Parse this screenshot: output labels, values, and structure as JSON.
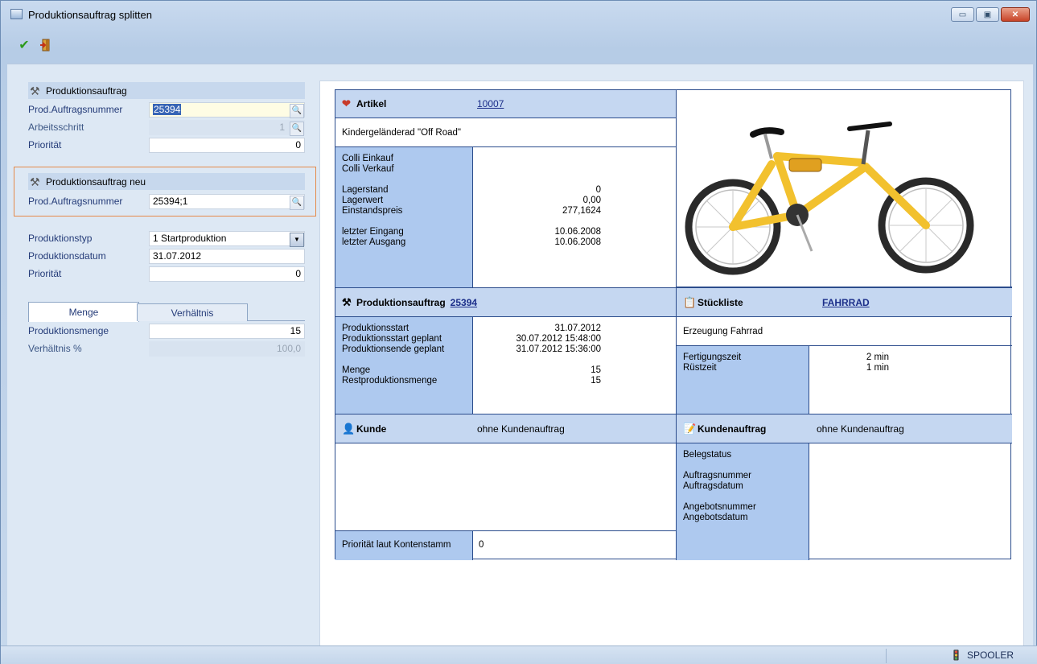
{
  "window": {
    "title": "Produktionsauftrag splitten",
    "controls": {
      "minimize": "▭",
      "maximize": "▣",
      "close": "✕"
    }
  },
  "toolbar": {
    "confirm_icon": "✔",
    "exit_icon": "🚪"
  },
  "left": {
    "group1": {
      "title": "Produktionsauftrag",
      "prod_nr_label": "Prod.Auftragsnummer",
      "prod_nr_value": "25394",
      "arbeitsschritt_label": "Arbeitsschritt",
      "arbeitsschritt_value": "1",
      "prioritaet_label": "Priorität",
      "prioritaet_value": "0"
    },
    "group2": {
      "title": "Produktionsauftrag neu",
      "prod_nr_label": "Prod.Auftragsnummer",
      "prod_nr_value": "25394;1"
    },
    "fields": {
      "produktionstyp_label": "Produktionstyp",
      "produktionstyp_value": "1 Startproduktion",
      "produktionsdatum_label": "Produktionsdatum",
      "produktionsdatum_value": "31.07.2012",
      "prioritaet_label": "Priorität",
      "prioritaet_value": "0"
    },
    "tabs": {
      "menge": "Menge",
      "verhaeltnis": "Verhältnis"
    },
    "tabcontent": {
      "produktionsmenge_label": "Produktionsmenge",
      "produktionsmenge_value": "15",
      "verhaeltnis_label": "Verhältnis %",
      "verhaeltnis_value": "100,0"
    }
  },
  "artikel": {
    "header": "Artikel",
    "nummer": "10007",
    "bezeichnung": "Kindergeländerad \"Off Road\"",
    "labels": [
      "Colli Einkauf",
      "Colli Verkauf",
      "",
      "Lagerstand",
      "Lagerwert",
      "Einstandspreis",
      "",
      "letzter Eingang",
      "letzter Ausgang"
    ],
    "values": [
      "",
      "",
      "",
      "0",
      "0,00",
      "277,1624",
      "",
      "10.06.2008",
      "10.06.2008"
    ]
  },
  "produktionsauftrag": {
    "header": "Produktionsauftrag",
    "nummer": "25394",
    "labels": [
      "Produktionsstart",
      "Produktionsstart geplant",
      "Produktionsende geplant",
      "",
      "Menge",
      "Restproduktionsmenge"
    ],
    "values": [
      "31.07.2012",
      "30.07.2012 15:48:00",
      "31.07.2012 15:36:00",
      "",
      "15",
      "15"
    ]
  },
  "stueckliste": {
    "header": "Stückliste",
    "nummer": "FAHRRAD",
    "bezeichnung": "Erzeugung Fahrrad",
    "labels": [
      "Fertigungszeit",
      "Rüstzeit"
    ],
    "values": [
      "2 min",
      "1 min"
    ]
  },
  "kunde": {
    "header": "Kunde",
    "value": "ohne Kundenauftrag",
    "prio_label": "Priorität laut Kontenstamm",
    "prio_value": "0"
  },
  "kundenauftrag": {
    "header": "Kundenauftrag",
    "value": "ohne Kundenauftrag",
    "labels": [
      "Belegstatus",
      "",
      "Auftragsnummer",
      "Auftragsdatum",
      "",
      "Angebotsnummer",
      "Angebotsdatum"
    ]
  },
  "statusbar": {
    "spooler": "SPOOLER"
  },
  "colors": {
    "header_bg": "#c5d7f1",
    "label_bg": "#aec9ef",
    "grid_border": "#2b4c8c",
    "highlight_frame": "#e58a4a"
  }
}
